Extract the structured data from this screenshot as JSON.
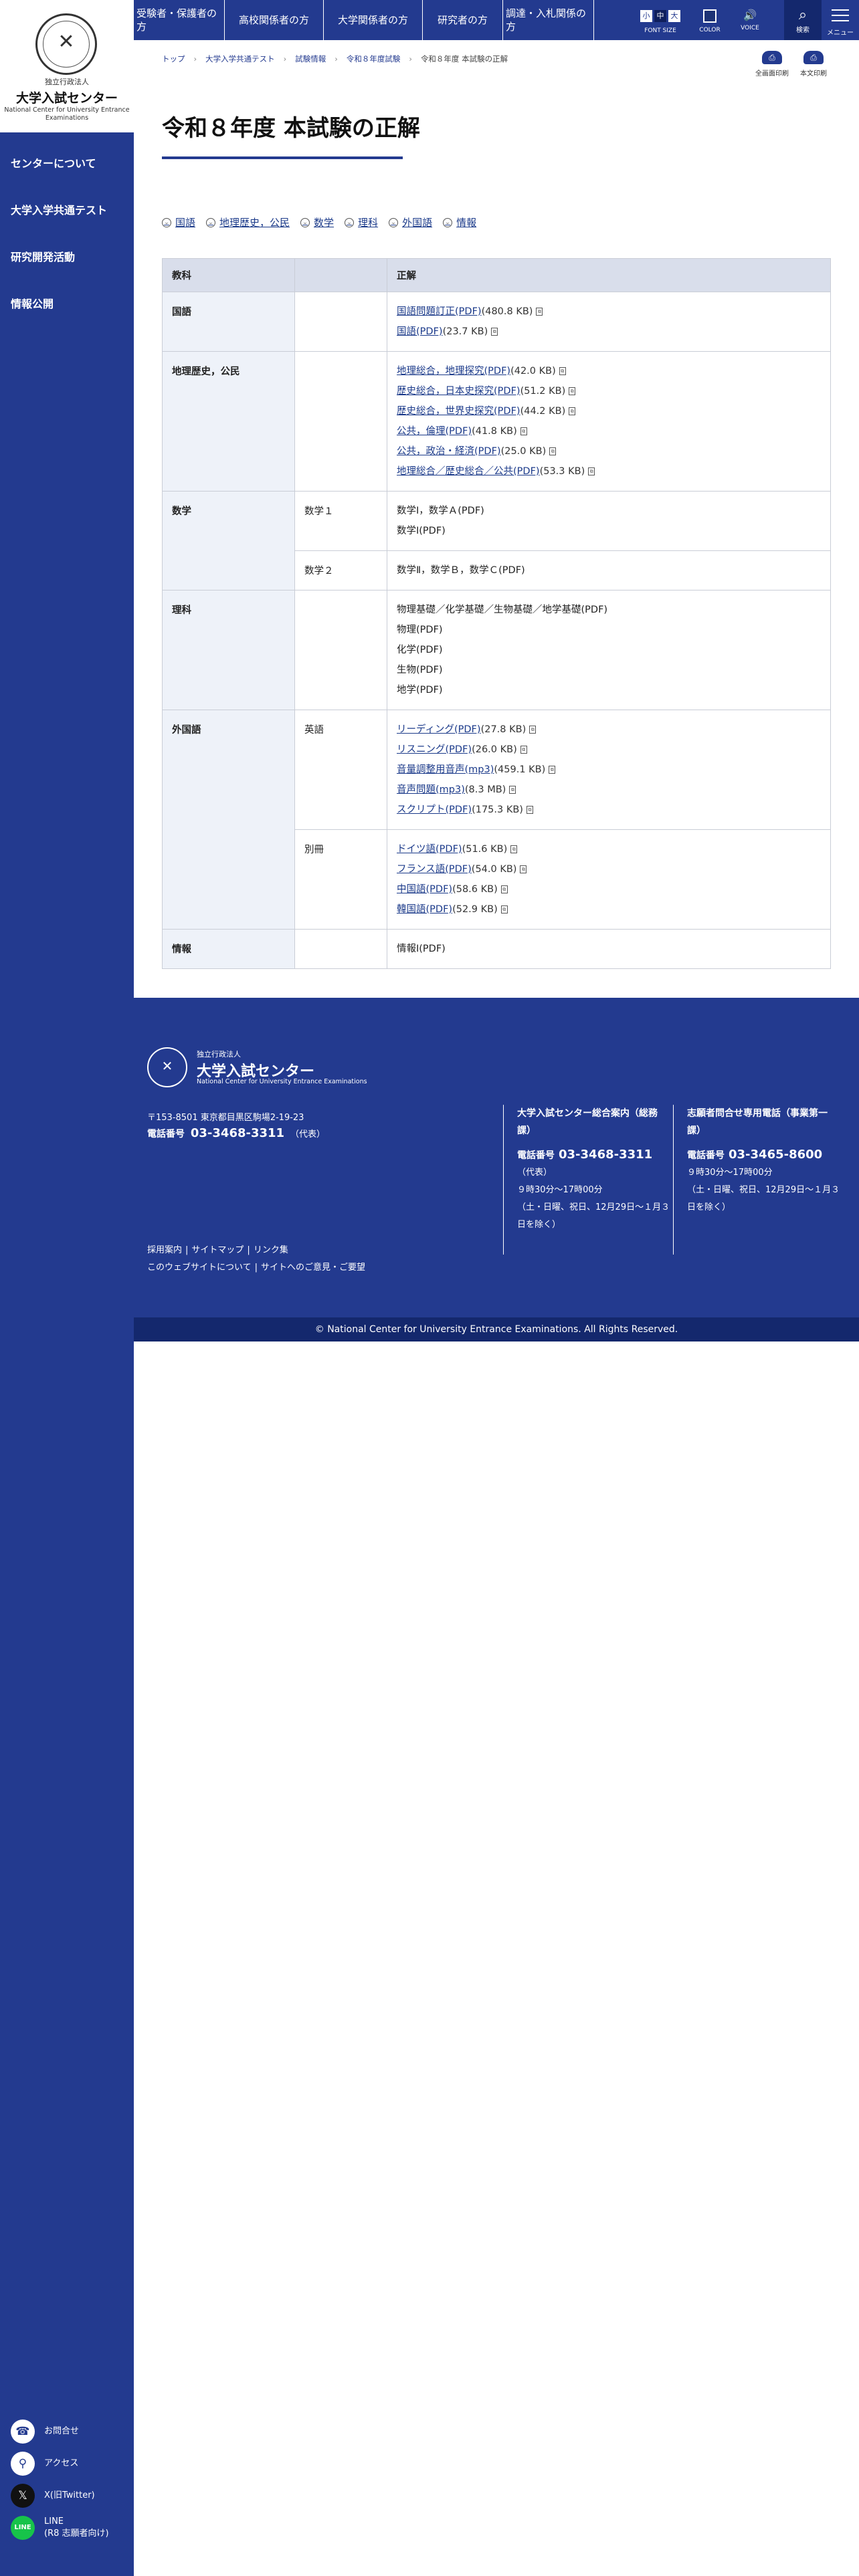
{
  "org": {
    "sub": "独立行政法人",
    "name": "大学入試センター",
    "name_en": "National Center for University Entrance Examinations"
  },
  "sidebar": {
    "items": [
      {
        "label": "センターについて"
      },
      {
        "label": "大学入学共通テスト"
      },
      {
        "label": "研究開発活動"
      },
      {
        "label": "情報公開"
      }
    ],
    "bottom": [
      {
        "label": "お問合せ",
        "icon": "phone-icon"
      },
      {
        "label": "アクセス",
        "icon": "map-pin-icon"
      },
      {
        "label": "X(旧Twitter)",
        "icon": "x-logo-icon"
      },
      {
        "label": "LINE",
        "label2": "(R8 志願者向け)",
        "icon": "line-logo-icon"
      }
    ]
  },
  "topnav": {
    "items": [
      {
        "label": "受験者・保護者の方"
      },
      {
        "label": "高校関係者の方"
      },
      {
        "label": "大学関係者の方"
      },
      {
        "label": "研究者の方"
      },
      {
        "label": "調達・入札関係の方"
      }
    ],
    "font_size_label": "FONT SIZE",
    "font_size_options": [
      "小",
      "中",
      "大"
    ],
    "color_label": "COLOR",
    "voice_label": "VOICE",
    "search_label": "検索",
    "menu_label": "メニュー"
  },
  "breadcrumb": [
    "トップ",
    "大学入学共通テスト",
    "試験情報",
    "令和８年度試験",
    "令和８年度 本試験の正解"
  ],
  "print": {
    "full": "全画面印刷",
    "body": "本文印刷"
  },
  "page_title": "令和８年度 本試験の正解",
  "anchors": [
    "国語",
    "地理歴史，公民",
    "数学",
    "理科",
    "外国語",
    "情報"
  ],
  "table": {
    "headers": [
      "教科",
      "",
      "正解"
    ],
    "rows": {
      "kokugo": {
        "subject": "国語",
        "sub": "",
        "answers": [
          {
            "text": "国語問題訂正(PDF)",
            "size": "(480.8 KB)",
            "link": true
          },
          {
            "text": "国語(PDF)",
            "size": "(23.7 KB)",
            "link": true
          }
        ]
      },
      "chireki": {
        "subject": "地理歴史，公民",
        "sub": "",
        "answers": [
          {
            "text": "地理総合，地理探究(PDF)",
            "size": "(42.0 KB)",
            "link": true
          },
          {
            "text": "歴史総合，日本史探究(PDF)",
            "size": "(51.2 KB)",
            "link": true
          },
          {
            "text": "歴史総合，世界史探究(PDF)",
            "size": "(44.2 KB)",
            "link": true
          },
          {
            "text": "公共，倫理(PDF)",
            "size": "(41.8 KB)",
            "link": true
          },
          {
            "text": "公共，政治・経済(PDF)",
            "size": "(25.0 KB)",
            "link": true
          },
          {
            "text": "地理総合／歴史総合／公共(PDF)",
            "size": "(53.3 KB)",
            "link": true
          }
        ]
      },
      "math1": {
        "subject": "数学",
        "sub": "数学１",
        "answers": [
          {
            "text": "数学Ⅰ，数学Ａ(PDF)",
            "size": "",
            "link": false
          },
          {
            "text": "数学Ⅰ(PDF)",
            "size": "",
            "link": false
          }
        ]
      },
      "math2": {
        "sub": "数学２",
        "answers": [
          {
            "text": "数学Ⅱ，数学Ｂ，数学Ｃ(PDF)",
            "size": "",
            "link": false
          }
        ]
      },
      "rika": {
        "subject": "理科",
        "sub": "",
        "answers": [
          {
            "text": "物理基礎／化学基礎／生物基礎／地学基礎(PDF)",
            "size": "",
            "link": false
          },
          {
            "text": "物理(PDF)",
            "size": "",
            "link": false
          },
          {
            "text": "化学(PDF)",
            "size": "",
            "link": false
          },
          {
            "text": "生物(PDF)",
            "size": "",
            "link": false
          },
          {
            "text": "地学(PDF)",
            "size": "",
            "link": false
          }
        ]
      },
      "eng": {
        "subject": "外国語",
        "sub": "英語",
        "answers": [
          {
            "text": "リーディング(PDF)",
            "size": "(27.8 KB)",
            "link": true
          },
          {
            "text": "リスニング(PDF)",
            "size": "(26.0 KB)",
            "link": true
          },
          {
            "text": "音量調整用音声(mp3)",
            "size": "(459.1 KB)",
            "link": true
          },
          {
            "text": "音声問題(mp3)",
            "size": "(8.3 MB)",
            "link": true
          },
          {
            "text": "スクリプト(PDF)",
            "size": "(175.3 KB)",
            "link": true
          }
        ]
      },
      "other": {
        "sub": "別冊",
        "answers": [
          {
            "text": "ドイツ語(PDF)",
            "size": "(51.6 KB)",
            "link": true
          },
          {
            "text": "フランス語(PDF)",
            "size": "(54.0 KB)",
            "link": true
          },
          {
            "text": "中国語(PDF)",
            "size": "(58.6 KB)",
            "link": true
          },
          {
            "text": "韓国語(PDF)",
            "size": "(52.9 KB)",
            "link": true
          }
        ]
      },
      "joho": {
        "subject": "情報",
        "sub": "",
        "answers": [
          {
            "text": "情報Ⅰ(PDF)",
            "size": "",
            "link": false
          }
        ]
      }
    }
  },
  "footer": {
    "address": "〒153-8501 東京都目黒区駒場2-19-23",
    "phone_label": "電話番号",
    "phone": "03-3468-3311",
    "phone_note": "（代表）",
    "links1": [
      "採用案内",
      "サイトマップ",
      "リンク集"
    ],
    "links2": [
      "このウェブサイトについて",
      "サイトへのご意見・ご要望"
    ],
    "col1": {
      "title": "大学入試センター総合案内（総務課）",
      "phone_label": "電話番号",
      "phone": "03-3468-3311",
      "note": "（代表）",
      "hours": "９時30分～17時00分",
      "closed": "（土・日曜、祝日、12月29日～１月３日を除く）"
    },
    "col2": {
      "title": "志願者問合せ専用電話（事業第一課）",
      "phone_label": "電話番号",
      "phone": "03-3465-8600",
      "hours": "９時30分～17時00分",
      "closed": "（土・日曜、祝日、12月29日～１月３日を除く）"
    },
    "copyright": "© National Center for University Entrance Examinations. All Rights Reserved."
  }
}
